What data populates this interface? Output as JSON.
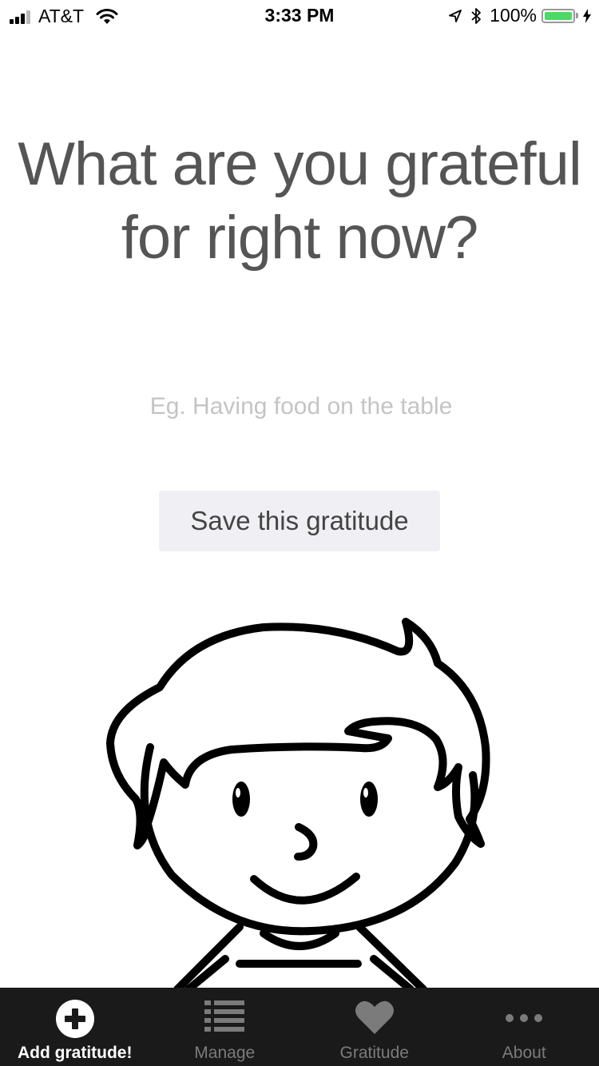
{
  "status_bar": {
    "carrier": "AT&T",
    "time": "3:33 PM",
    "battery_percent": "100%",
    "battery_level": 1.0,
    "battery_color": "#4cd964",
    "icons": [
      "signal-icon",
      "wifi-icon",
      "location-arrow-icon",
      "bluetooth-icon",
      "battery-icon",
      "charging-bolt-icon"
    ]
  },
  "main": {
    "prompt_line1": "What are you grateful",
    "prompt_line2": "for right now?",
    "input": {
      "placeholder": "Eg. Having food on the table",
      "value": ""
    },
    "save_label": "Save this gratitude",
    "illustration": "smiling-boy-illustration"
  },
  "tab_bar": {
    "active_index": 0,
    "tabs": [
      {
        "label": "Add gratitude!",
        "icon": "add-circle-icon"
      },
      {
        "label": "Manage",
        "icon": "list-icon"
      },
      {
        "label": "Gratitude",
        "icon": "heart-icon"
      },
      {
        "label": "About",
        "icon": "more-dots-icon"
      }
    ]
  }
}
